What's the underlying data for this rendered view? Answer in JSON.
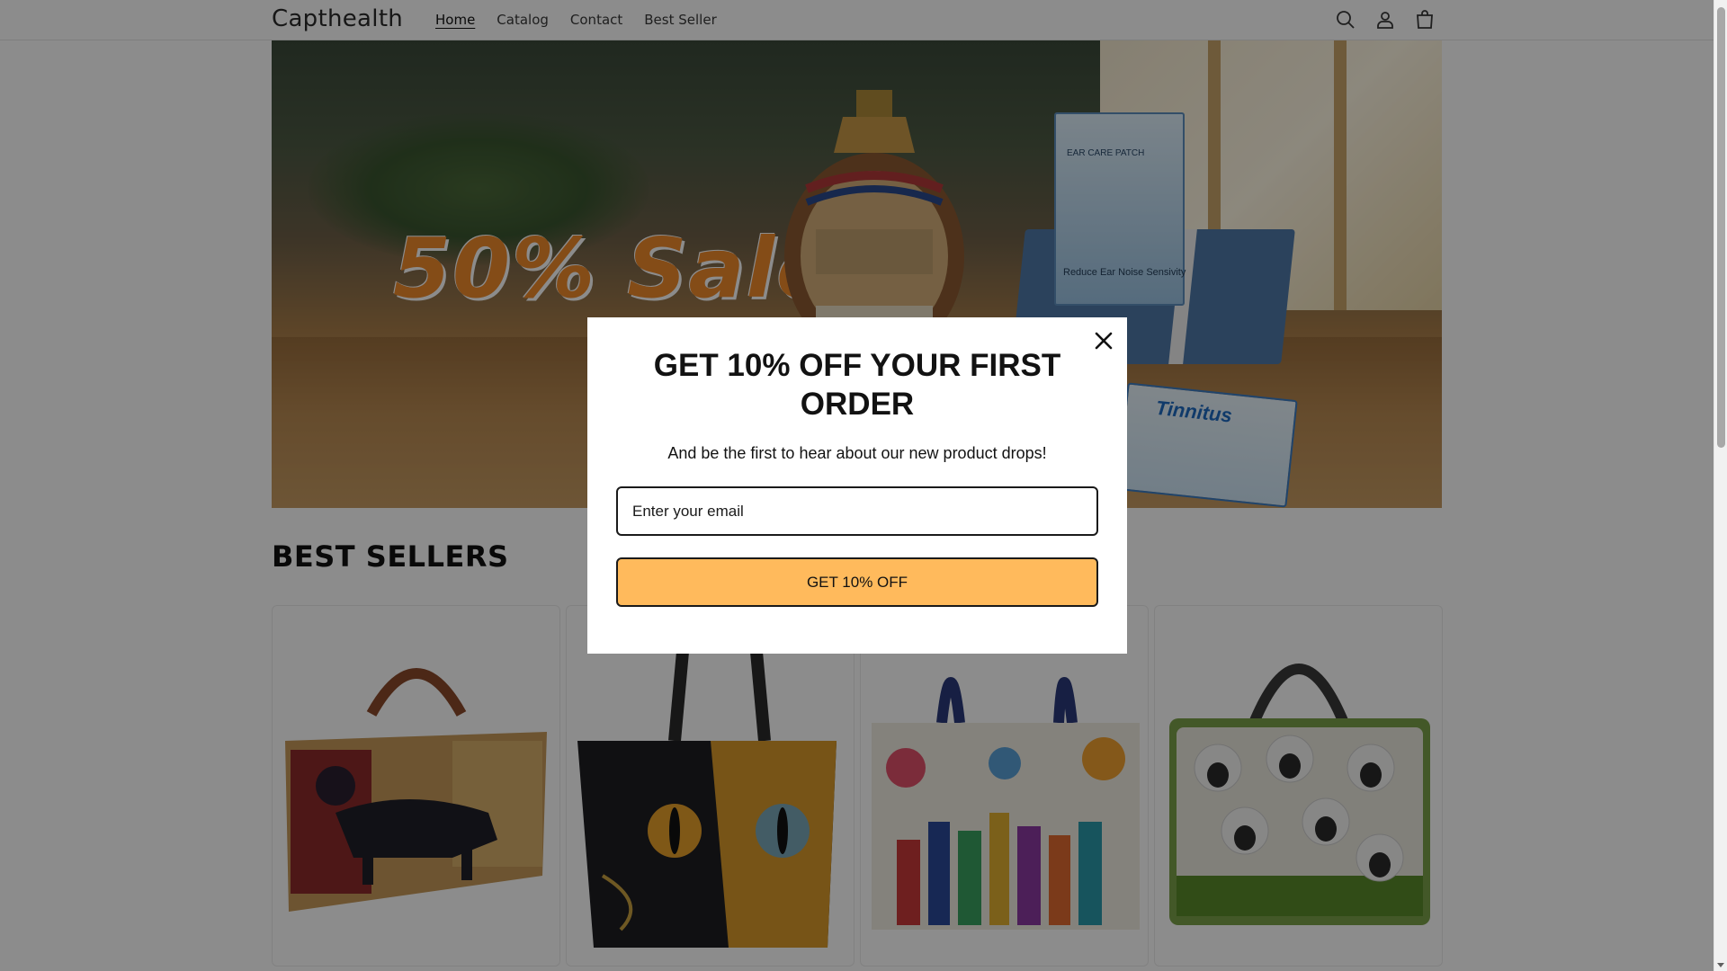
{
  "header": {
    "logo": "Capthealth",
    "nav": [
      {
        "label": "Home",
        "active": true
      },
      {
        "label": "Catalog",
        "active": false
      },
      {
        "label": "Contact",
        "active": false
      },
      {
        "label": "Best Seller",
        "active": false
      }
    ],
    "icons": [
      "search-icon",
      "account-icon",
      "cart-icon"
    ]
  },
  "hero": {
    "sale_text": "50% Sale",
    "ear_box_title": "EAR CARE PATCH",
    "ear_box_text": "Reduce Ear Noise Sensivity",
    "card_text": "Tinnitus",
    "accent_color": "#f08a2a"
  },
  "best_sellers": {
    "title": "BEST SELLERS",
    "products": [
      {
        "name": "dachshund-quilted-tote"
      },
      {
        "name": "black-cat-quilted-tote"
      },
      {
        "name": "floral-books-quilted-tote"
      },
      {
        "name": "sheep-quilted-tote"
      }
    ]
  },
  "popup": {
    "title": "GET 10% OFF YOUR FIRST ORDER",
    "subtitle": "And be the first to hear about our new product drops!",
    "email_placeholder": "Enter your email",
    "cta_label": "GET 10% OFF",
    "cta_color": "#ffba5c"
  }
}
